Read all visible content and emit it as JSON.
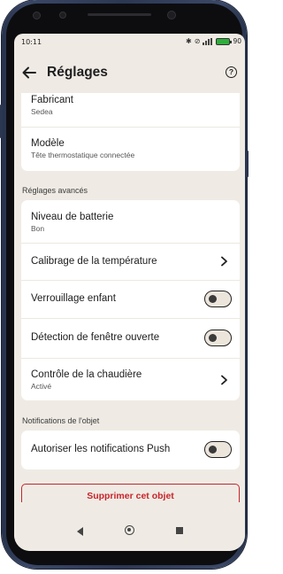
{
  "status": {
    "time": "10:11",
    "battery": "90"
  },
  "header": {
    "title": "Réglages"
  },
  "device_info": {
    "manufacturer_label": "Fabricant",
    "manufacturer_value": "Sedea",
    "model_label": "Modèle",
    "model_value": "Tête thermostatique connectée"
  },
  "advanced": {
    "section_title": "Réglages avancés",
    "battery_label": "Niveau de batterie",
    "battery_value": "Bon",
    "calibration_label": "Calibrage de la température",
    "child_lock_label": "Verrouillage enfant",
    "child_lock_on": false,
    "window_detection_label": "Détection de fenêtre ouverte",
    "window_detection_on": false,
    "boiler_label": "Contrôle de la chaudière",
    "boiler_value": "Activé"
  },
  "notifications": {
    "section_title": "Notifications de l'objet",
    "push_label": "Autoriser les notifications Push",
    "push_on": false
  },
  "actions": {
    "delete_label": "Supprimer cet objet"
  },
  "colors": {
    "background": "#efebe4",
    "card": "#ffffff",
    "danger": "#c8242b"
  }
}
